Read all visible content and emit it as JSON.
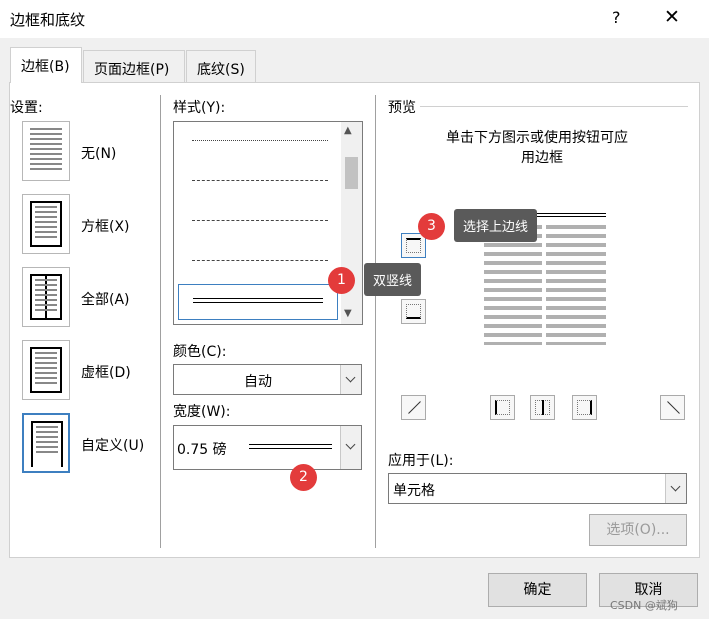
{
  "window": {
    "title": "边框和底纹",
    "help": "?",
    "close": "✕"
  },
  "tabs": [
    {
      "label": "边框(B)"
    },
    {
      "label": "页面边框(P)"
    },
    {
      "label": "底纹(S)"
    }
  ],
  "settings": {
    "title": "设置:",
    "items": [
      {
        "label": "无(N)"
      },
      {
        "label": "方框(X)"
      },
      {
        "label": "全部(A)"
      },
      {
        "label": "虚框(D)"
      },
      {
        "label": "自定义(U)"
      }
    ]
  },
  "style": {
    "title": "样式(Y):"
  },
  "color": {
    "title": "颜色(C):",
    "value": "自动"
  },
  "width": {
    "title": "宽度(W):",
    "value": "0.75 磅"
  },
  "preview": {
    "title": "预览",
    "hint_line1": "单击下方图示或使用按钮可应",
    "hint_line2": "用边框"
  },
  "apply_to": {
    "title": "应用于(L):",
    "value": "单元格"
  },
  "options_button": "选项(O)...",
  "ok_button": "确定",
  "cancel_button": "取消",
  "annotations": {
    "badge1": "1",
    "tip1": "双竖线",
    "badge2": "2",
    "badge3": "3",
    "tip3": "选择上边线"
  },
  "watermark": "CSDN @斌狗",
  "colors": {
    "accent": "#3d7fc0",
    "badge": "#e33b3b",
    "tooltip": "#5a5a5a"
  }
}
